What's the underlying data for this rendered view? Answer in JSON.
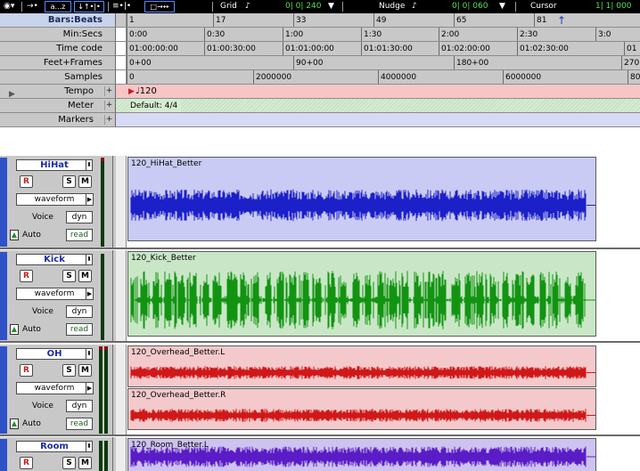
{
  "toolbar": {
    "mode_icon": "◉▾",
    "edit_arrows": "→•",
    "az_button": "a...z",
    "tool_a": "↓↑•|•",
    "tool_b": "≡•|•",
    "tool_c": "□→↔",
    "grid_label": "Grid",
    "grid_value": "0| 0| 240",
    "nudge_label": "Nudge",
    "nudge_value": "0| 0| 060",
    "cursor_label": "Cursor",
    "cursor_value": "1| 1| 000"
  },
  "rulers": {
    "bars_beats": {
      "label": "Bars:Beats",
      "ticks": [
        "1",
        "17",
        "33",
        "49",
        "65",
        "81"
      ]
    },
    "min_secs": {
      "label": "Min:Secs",
      "ticks": [
        "0:00",
        "0:30",
        "1:00",
        "1:30",
        "2:00",
        "2:30",
        "3:0"
      ]
    },
    "time_code": {
      "label": "Time code",
      "ticks": [
        "01:00:00:00",
        "01:00:30:00",
        "01:01:00:00",
        "01:01:30:00",
        "01:02:00:00",
        "01:02:30:00",
        "01"
      ]
    },
    "feet_frames": {
      "label": "Feet+Frames",
      "ticks": [
        "0+00",
        "90+00",
        "180+00",
        "270"
      ]
    },
    "samples": {
      "label": "Samples",
      "ticks": [
        "0",
        "2000000",
        "4000000",
        "6000000",
        "80"
      ]
    },
    "tempo": {
      "label": "Tempo",
      "value": "♩120",
      "plus": "+"
    },
    "meter": {
      "label": "Meter",
      "value": "Default: 4/4",
      "plus": "+"
    },
    "markers": {
      "label": "Markers",
      "plus": "+"
    }
  },
  "tracks": [
    {
      "name": "HiHat",
      "r": "R",
      "s": "S",
      "m": "M",
      "view": "waveform",
      "voice_label": "Voice",
      "voice_value": "dyn",
      "auto_label": "Auto",
      "auto_value": "read",
      "regions": [
        {
          "name": "120_HiHat_Better"
        }
      ]
    },
    {
      "name": "Kick",
      "r": "R",
      "s": "S",
      "m": "M",
      "view": "waveform",
      "voice_label": "Voice",
      "voice_value": "dyn",
      "auto_label": "Auto",
      "auto_value": "read",
      "regions": [
        {
          "name": "120_Kick_Better"
        }
      ]
    },
    {
      "name": "OH",
      "r": "R",
      "s": "S",
      "m": "M",
      "view": "waveform",
      "voice_label": "Voice",
      "voice_value": "dyn",
      "auto_label": "Auto",
      "auto_value": "read",
      "regions": [
        {
          "name": "120_Overhead_Better.L"
        },
        {
          "name": "120_Overhead_Better.R"
        }
      ]
    },
    {
      "name": "Room",
      "r": "R",
      "s": "S",
      "m": "M",
      "regions": [
        {
          "name": "120_Room_Better.L"
        }
      ]
    }
  ],
  "colors": {
    "hihat_wave": "#1c20c9",
    "kick_wave": "#129412",
    "oh_wave": "#d01818",
    "room_wave": "#5a1cc6"
  }
}
